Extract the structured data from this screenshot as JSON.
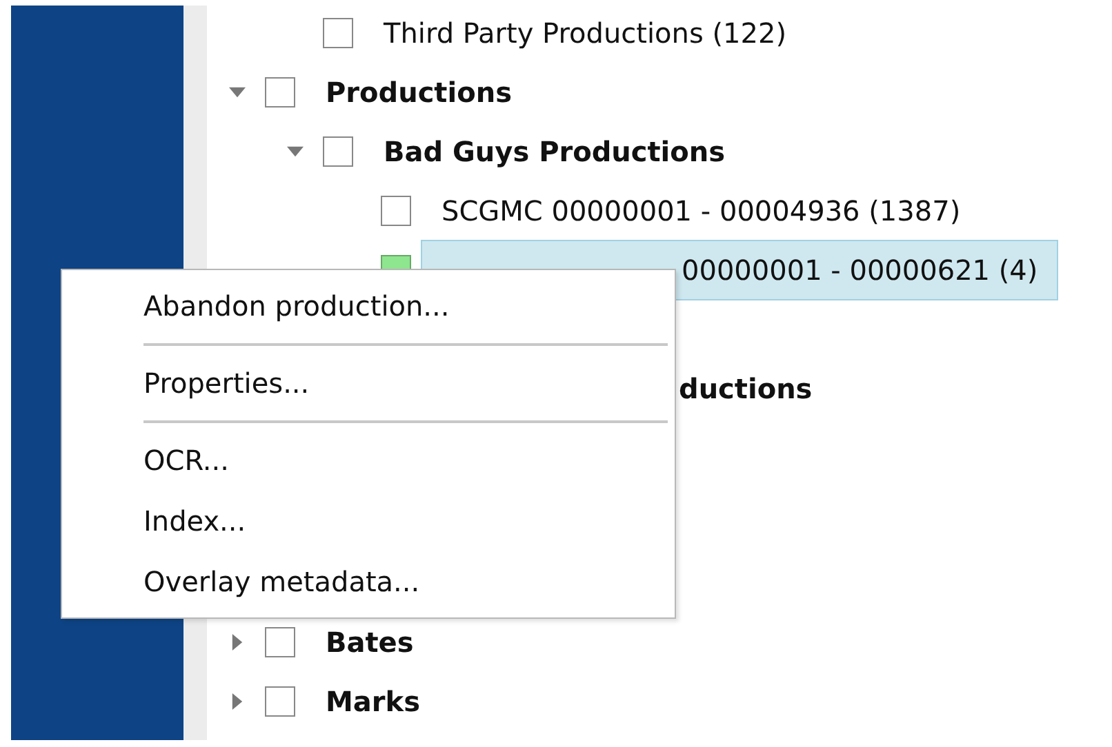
{
  "tree": [
    {
      "children": [
        {
          "label": "Third Party Productions (122)",
          "bold": false,
          "checked": false,
          "selected": false
        }
      ]
    },
    {
      "label": "Productions",
      "bold": true,
      "expanded": true,
      "checked": false,
      "selected": false,
      "children": [
        {
          "label": "Bad Guys Productions",
          "bold": true,
          "expanded": true,
          "checked": false,
          "selected": false,
          "children": [
            {
              "label": "SCGMC 00000001 - 00004936 (1387)",
              "bold": false,
              "checked": false,
              "selected": false
            },
            {
              "kind": "covered",
              "label": "00000001 - 00000621 (4)",
              "bold": false,
              "checked": true,
              "selected": true
            }
          ]
        },
        {
          "kind": "cut",
          "label": "ductions",
          "bold": true
        }
      ]
    },
    {
      "label": "Bates",
      "bold": true,
      "expanded": false,
      "checked": false,
      "selected": false
    },
    {
      "label": "Marks",
      "bold": true,
      "expanded": false,
      "checked": false,
      "selected": false
    }
  ],
  "context_menu": [
    {
      "label": "Abandon production...",
      "separator_after": true
    },
    {
      "label": "Properties...",
      "separator_after": true
    },
    {
      "label": "OCR...",
      "separator_after": false
    },
    {
      "label": "Index...",
      "separator_after": false
    },
    {
      "label": "Overlay metadata...",
      "separator_after": false
    }
  ]
}
